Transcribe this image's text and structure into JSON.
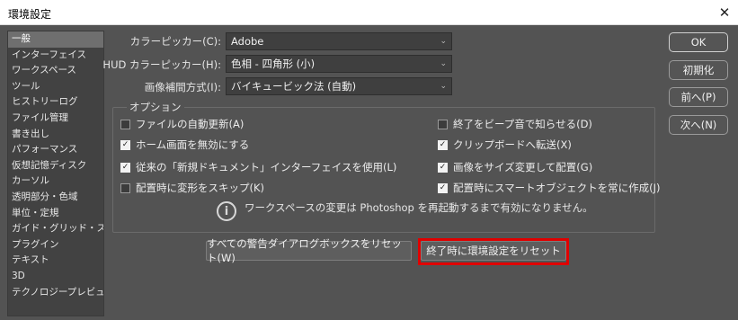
{
  "window": {
    "title": "環境設定",
    "close_glyph": "✕"
  },
  "sidebar": {
    "items": [
      {
        "label": "一般",
        "active": true
      },
      {
        "label": "インターフェイス"
      },
      {
        "label": "ワークスペース"
      },
      {
        "label": "ツール"
      },
      {
        "label": "ヒストリーログ"
      },
      {
        "label": "ファイル管理"
      },
      {
        "label": "書き出し"
      },
      {
        "label": "パフォーマンス"
      },
      {
        "label": "仮想記憶ディスク"
      },
      {
        "label": "カーソル"
      },
      {
        "label": "透明部分・色域"
      },
      {
        "label": "単位・定規"
      },
      {
        "label": "ガイド・グリッド・スライス"
      },
      {
        "label": "プラグイン"
      },
      {
        "label": "テキスト"
      },
      {
        "label": "3D"
      },
      {
        "label": "テクノロジープレビュー"
      }
    ]
  },
  "fields": {
    "color_picker": {
      "label": "カラーピッカー(C):",
      "value": "Adobe"
    },
    "hud_color_picker": {
      "label": "HUD カラーピッカー(H):",
      "value": "色相 - 四角形 (小)"
    },
    "interpolation": {
      "label": "画像補間方式(I):",
      "value": "バイキュービック法 (自動)"
    }
  },
  "options": {
    "legend": "オプション",
    "left": [
      {
        "label": "ファイルの自動更新(A)",
        "checked": false
      },
      {
        "label": "ホーム画面を無効にする",
        "checked": true
      },
      {
        "label": "従来の「新規ドキュメント」インターフェイスを使用(L)",
        "checked": true
      },
      {
        "label": "配置時に変形をスキップ(K)",
        "checked": false
      }
    ],
    "right": [
      {
        "label": "終了をビープ音で知らせる(D)",
        "checked": false
      },
      {
        "label": "クリップボードへ転送(X)",
        "checked": true
      },
      {
        "label": "画像をサイズ変更して配置(G)",
        "checked": true
      },
      {
        "label": "配置時にスマートオブジェクトを常に作成(J)",
        "checked": true
      }
    ],
    "info_icon_glyph": "i",
    "info_text": "ワークスペースの変更は Photoshop を再起動するまで有効になりません。"
  },
  "buttons": {
    "reset_warnings": "すべての警告ダイアログボックスをリセット(W)",
    "reset_on_quit": "終了時に環境設定をリセット",
    "ok": "OK",
    "reset": "初期化",
    "prev": "前へ(P)",
    "next": "次へ(N)"
  },
  "colors": {
    "background": "#535353",
    "highlight": "#e00000"
  }
}
